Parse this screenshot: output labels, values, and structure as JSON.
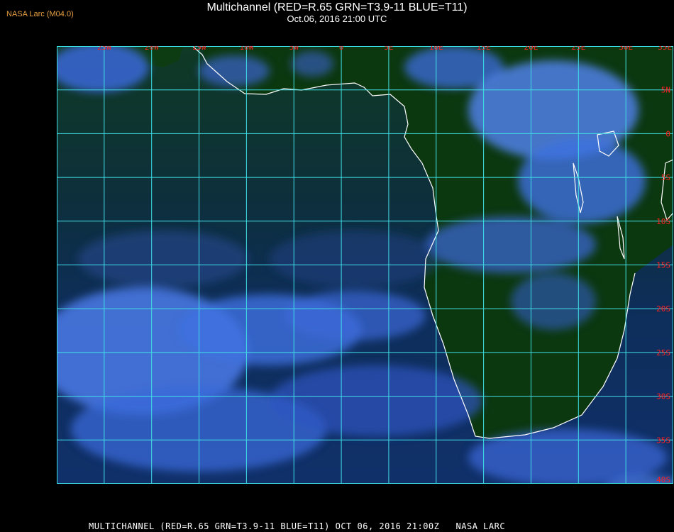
{
  "header": {
    "credit": "NASA Larc (M04.0)",
    "title": "Multichannel (RED=R.65 GRN=T3.9-11 BLUE=T11)",
    "subtitle": "Oct.06, 2016 21:00 UTC"
  },
  "map": {
    "lon_labels": [
      "25W",
      "20W",
      "15W",
      "10W",
      "5W",
      "0",
      "5E",
      "10E",
      "15E",
      "20E",
      "25E",
      "30E",
      "35E"
    ],
    "lat_labels": [
      "5N",
      "0",
      "5S",
      "10S",
      "15S",
      "20S",
      "25S",
      "30S",
      "35S",
      "40S"
    ],
    "lon_range": [
      -30,
      35
    ],
    "lat_range": [
      10,
      -40
    ],
    "colors": {
      "grid": "#40e0e8",
      "grid_label": "#ff2020",
      "coast": "#ffffff",
      "land": "#0c3a10",
      "ocean": "#0d2a5c",
      "cloud": "#4a78e8",
      "credit": "#e8a040"
    }
  },
  "footer": {
    "text": "MULTICHANNEL (RED=R.65 GRN=T3.9-11 BLUE=T11) OCT 06, 2016 21:00Z   NASA LARC"
  }
}
